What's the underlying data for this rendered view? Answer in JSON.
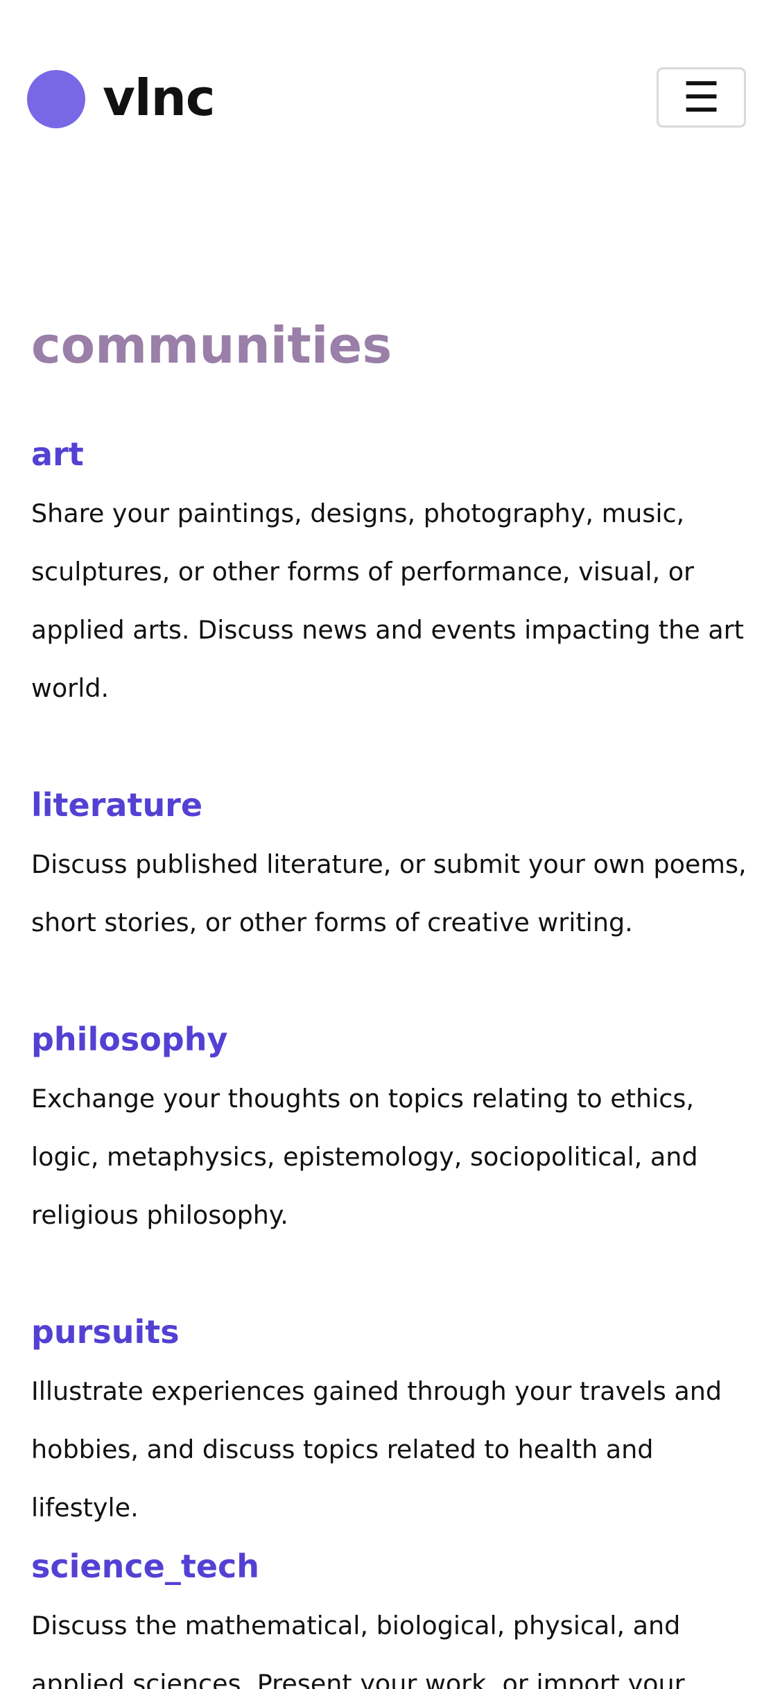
{
  "header": {
    "logo_text": "vlnc",
    "menu_glyph": "☰",
    "logo_color": "#7868e6"
  },
  "page": {
    "title": "communities",
    "title_color": "#9a7fa8",
    "link_color": "#5440d3"
  },
  "communities": [
    {
      "name": "art",
      "description": "Share your paintings, designs, photography, music, sculptures, or other forms of performance, visual, or applied arts. Discuss news and events impacting the art world."
    },
    {
      "name": "literature",
      "description": "Discuss published literature, or submit your own poems, short stories, or other forms of creative writing."
    },
    {
      "name": "philosophy",
      "description": "Exchange your thoughts on topics relating to ethics, logic, metaphysics, epistemology, sociopolitical, and religious philosophy."
    },
    {
      "name": "pursuits",
      "description": "Illustrate experiences gained through your travels and hobbies, and discuss topics related to health and lifestyle."
    },
    {
      "name": "science_tech",
      "description": "Discuss the mathematical, biological, physical, and applied sciences. Present your work, or import your"
    }
  ]
}
